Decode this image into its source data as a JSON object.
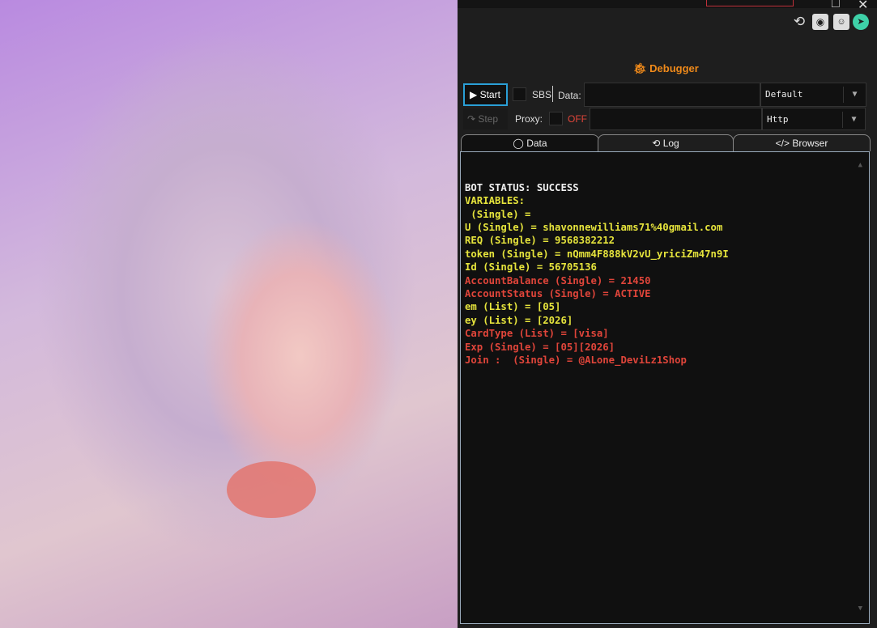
{
  "toolbar": {
    "debugger_label": "Debugger",
    "start_label": "Start",
    "step_label": "Step",
    "sbs_label": "SBS",
    "data_label": "Data:",
    "data_value": "",
    "data_type": "Default",
    "proxy_label": "Proxy:",
    "proxy_state": "OFF",
    "proxy_value": "",
    "proxy_type": "Http"
  },
  "tabs": [
    {
      "label": "Data",
      "icon": "circle-icon"
    },
    {
      "label": "Log",
      "icon": "history-icon"
    },
    {
      "label": "Browser",
      "icon": "code-icon"
    }
  ],
  "output": {
    "lines": [
      {
        "text": "BOT STATUS: SUCCESS",
        "color": "white"
      },
      {
        "text": "VARIABLES:",
        "color": "yellow"
      },
      {
        "text": " (Single) =",
        "color": "yellow"
      },
      {
        "text": "U (Single) = shavonnewilliams71%40gmail.com",
        "color": "yellow"
      },
      {
        "text": "REQ (Single) = 9568382212",
        "color": "yellow"
      },
      {
        "text": "token (Single) = nQmm4F888kV2vU_yriciZm47n9I",
        "color": "yellow"
      },
      {
        "text": "Id (Single) = 56705136",
        "color": "yellow"
      },
      {
        "text": "AccountBalance (Single) = 21450",
        "color": "red"
      },
      {
        "text": "AccountStatus (Single) = ACTIVE",
        "color": "red"
      },
      {
        "text": "em (List) = [05]",
        "color": "yellow"
      },
      {
        "text": "ey (List) = [2026]",
        "color": "yellow"
      },
      {
        "text": "CardType (List) = [visa]",
        "color": "red"
      },
      {
        "text": "Exp (Single) = [05][2026]",
        "color": "red"
      },
      {
        "text": "Join :  (Single) = @ALone_DeviLz1Shop",
        "color": "red"
      }
    ]
  },
  "colors": {
    "white": "#f0f0f0",
    "yellow": "#e6e43c",
    "red": "#e0453a",
    "accent": "#2a9fd6",
    "debugger": "#f08a1a"
  }
}
